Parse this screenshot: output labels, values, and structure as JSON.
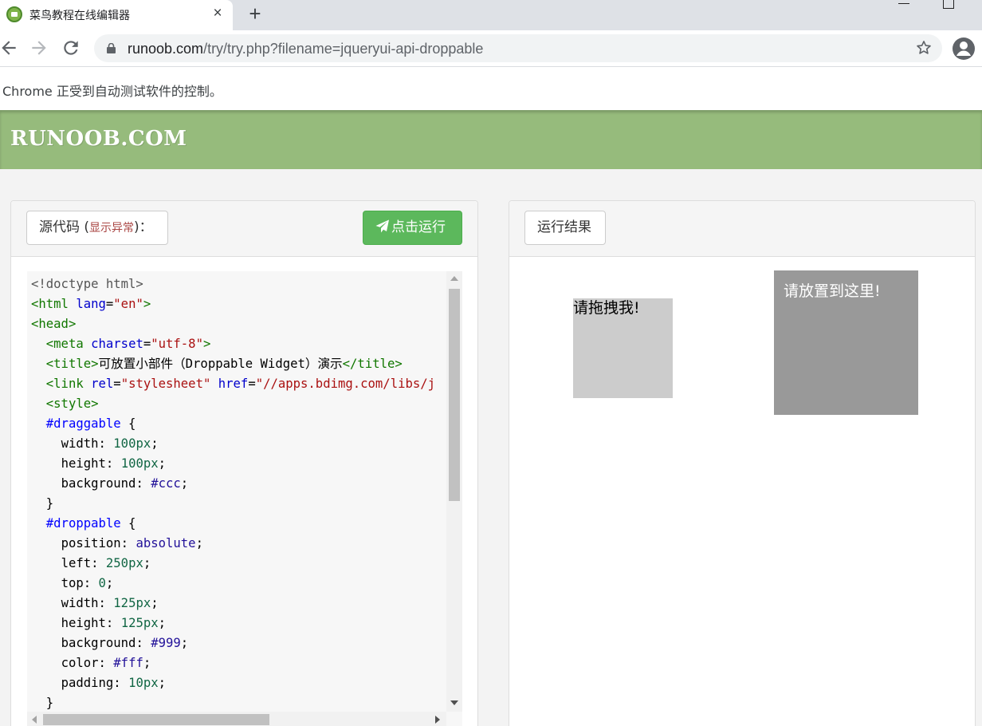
{
  "browser": {
    "tab_title": "菜鸟教程在线编辑器",
    "tab_close_icon": "×",
    "new_tab_icon": "+",
    "url_host": "runoob.com",
    "url_path": "/try/try.php?filename=jqueryui-api-droppable",
    "infobar_text": "Chrome 正受到自动测试软件的控制。"
  },
  "site": {
    "logo_text": "RUNOOB.COM",
    "header_color": "#96bb7c"
  },
  "left_panel": {
    "source_label": "源代码",
    "error_prefix": " (",
    "error_link": "显示异常",
    "error_suffix": ")：",
    "run_button_label": "点击运行",
    "run_button_color": "#5cb85c"
  },
  "right_panel": {
    "result_label": "运行结果",
    "draggable_text": "请拖拽我!",
    "droppable_text": "请放置到这里!"
  },
  "code_lines": [
    [
      [
        "doctype",
        "<!doctype html>"
      ]
    ],
    [
      [
        "tag",
        "<html "
      ],
      [
        "attr",
        "lang"
      ],
      [
        "text",
        "="
      ],
      [
        "str",
        "\"en\""
      ],
      [
        "tag",
        ">"
      ]
    ],
    [
      [
        "tag",
        "<head>"
      ]
    ],
    [
      [
        "text",
        "  "
      ],
      [
        "tag",
        "<meta "
      ],
      [
        "attr",
        "charset"
      ],
      [
        "text",
        "="
      ],
      [
        "str",
        "\"utf-8\""
      ],
      [
        "tag",
        ">"
      ]
    ],
    [
      [
        "text",
        "  "
      ],
      [
        "tag",
        "<title>"
      ],
      [
        "text",
        "可放置小部件（Droppable Widget）演示"
      ],
      [
        "tag",
        "</title>"
      ]
    ],
    [
      [
        "text",
        "  "
      ],
      [
        "tag",
        "<link "
      ],
      [
        "attr",
        "rel"
      ],
      [
        "text",
        "="
      ],
      [
        "str",
        "\"stylesheet\""
      ],
      [
        "text",
        " "
      ],
      [
        "attr",
        "href"
      ],
      [
        "text",
        "="
      ],
      [
        "str",
        "\"//apps.bdimg.com/libs/j"
      ]
    ],
    [
      [
        "text",
        "  "
      ],
      [
        "tag",
        "<style>"
      ]
    ],
    [
      [
        "text",
        "  "
      ],
      [
        "sel",
        "#draggable"
      ],
      [
        "text",
        " {"
      ]
    ],
    [
      [
        "text",
        "    "
      ],
      [
        "prop",
        "width"
      ],
      [
        "text",
        ": "
      ],
      [
        "num",
        "100px"
      ],
      [
        "text",
        ";"
      ]
    ],
    [
      [
        "text",
        "    "
      ],
      [
        "prop",
        "height"
      ],
      [
        "text",
        ": "
      ],
      [
        "num",
        "100px"
      ],
      [
        "text",
        ";"
      ]
    ],
    [
      [
        "text",
        "    "
      ],
      [
        "prop",
        "background"
      ],
      [
        "text",
        ": "
      ],
      [
        "kw",
        "#ccc"
      ],
      [
        "text",
        ";"
      ]
    ],
    [
      [
        "text",
        "  }"
      ]
    ],
    [
      [
        "text",
        "  "
      ],
      [
        "sel",
        "#droppable"
      ],
      [
        "text",
        " {"
      ]
    ],
    [
      [
        "text",
        "    "
      ],
      [
        "prop",
        "position"
      ],
      [
        "text",
        ": "
      ],
      [
        "kw",
        "absolute"
      ],
      [
        "text",
        ";"
      ]
    ],
    [
      [
        "text",
        "    "
      ],
      [
        "prop",
        "left"
      ],
      [
        "text",
        ": "
      ],
      [
        "num",
        "250px"
      ],
      [
        "text",
        ";"
      ]
    ],
    [
      [
        "text",
        "    "
      ],
      [
        "prop",
        "top"
      ],
      [
        "text",
        ": "
      ],
      [
        "num",
        "0"
      ],
      [
        "text",
        ";"
      ]
    ],
    [
      [
        "text",
        "    "
      ],
      [
        "prop",
        "width"
      ],
      [
        "text",
        ": "
      ],
      [
        "num",
        "125px"
      ],
      [
        "text",
        ";"
      ]
    ],
    [
      [
        "text",
        "    "
      ],
      [
        "prop",
        "height"
      ],
      [
        "text",
        ": "
      ],
      [
        "num",
        "125px"
      ],
      [
        "text",
        ";"
      ]
    ],
    [
      [
        "text",
        "    "
      ],
      [
        "prop",
        "background"
      ],
      [
        "text",
        ": "
      ],
      [
        "kw",
        "#999"
      ],
      [
        "text",
        ";"
      ]
    ],
    [
      [
        "text",
        "    "
      ],
      [
        "prop",
        "color"
      ],
      [
        "text",
        ": "
      ],
      [
        "kw",
        "#fff"
      ],
      [
        "text",
        ";"
      ]
    ],
    [
      [
        "text",
        "    "
      ],
      [
        "prop",
        "padding"
      ],
      [
        "text",
        ": "
      ],
      [
        "num",
        "10px"
      ],
      [
        "text",
        ";"
      ]
    ],
    [
      [
        "text",
        "  }"
      ]
    ]
  ]
}
